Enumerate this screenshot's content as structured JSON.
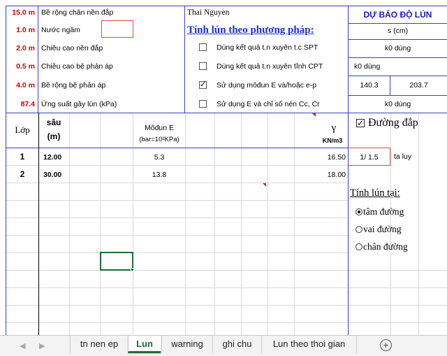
{
  "header_rows": [
    {
      "value": "15.0 m",
      "label": "Bề rộng chân nền đắp"
    },
    {
      "value": "1.0 m",
      "label": "Nước ngầm"
    },
    {
      "value": "2.0 m",
      "label": "Chiều cao nền đắp"
    },
    {
      "value": "0.5 m",
      "label": "Chiều cao bệ phản áp"
    },
    {
      "value": "4.0 m",
      "label": "Bề rộng bệ phản áp"
    },
    {
      "value": "87.4",
      "label": "Ứng suất gây lún (kPa)"
    }
  ],
  "location": "Thai Nguyen",
  "method_title": "Tính lún theo phương pháp:",
  "methods": [
    {
      "label": "Dùng kết quả t.n xuyên t.c SPT",
      "checked": false
    },
    {
      "label": "Dùng kết quả t.n xuyên tĩnh CPT",
      "checked": false
    },
    {
      "label": "Sử dụng môđun E và/hoặc e-p",
      "checked": true
    },
    {
      "label": "Sử dụng E và chỉ số nén Cc, Cr",
      "checked": false
    }
  ],
  "forecast": {
    "title": "DỰ BÁO ĐỘ LÚN",
    "unit": "s (cm)",
    "row1": "k0 dùng",
    "row2": "k0 dùng",
    "val_a": "140.3",
    "val_b": "203.7",
    "row4": "k0 dùng"
  },
  "table": {
    "col_lop": "Lớp",
    "col_sau": "sâu",
    "col_sau_unit": "(m)",
    "col_modun": "Môđun E",
    "col_modun_unit": "(bar=10²KPa)",
    "col_gamma": "γ",
    "col_gamma_unit": "KN/m3",
    "rows": [
      {
        "lop": "1",
        "sau": "12.00",
        "modun": "5.3",
        "gamma": "16.50"
      },
      {
        "lop": "2",
        "sau": "30.00",
        "modun": "13.8",
        "gamma": "18.00"
      }
    ]
  },
  "duong_dap": {
    "label": "Đường đắp",
    "checked": true
  },
  "slope": {
    "value": "1/ 1.5",
    "label": "ta luy"
  },
  "tinh_lun": {
    "title": "Tính lún tại:",
    "options": [
      {
        "label": "tâm đường",
        "selected": true
      },
      {
        "label": "vai đường",
        "selected": false
      },
      {
        "label": "chân đường",
        "selected": false
      }
    ]
  },
  "tabs": {
    "items": [
      "tn nen ep",
      "Lun",
      "warning",
      "ghi chu",
      "Lun theo thoi gian"
    ],
    "active": "Lun",
    "add_symbol": "⊕",
    "prev": "◀",
    "next": "▶"
  },
  "colors": {
    "accent": "#1d6b34",
    "border_blue": "#3b3bd1",
    "value_red": "#cc0000"
  }
}
